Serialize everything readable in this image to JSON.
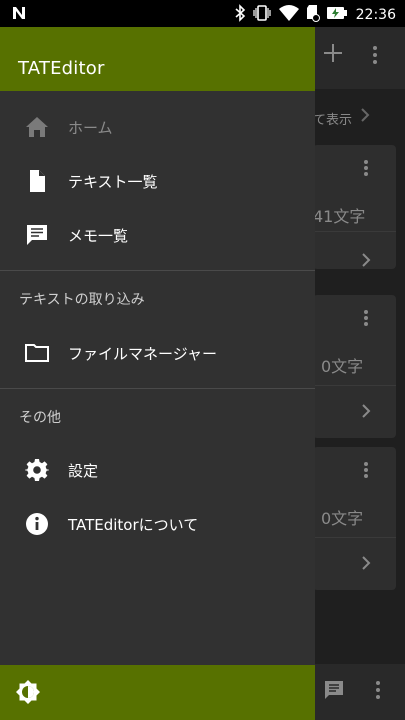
{
  "status_bar": {
    "time": "22:36",
    "left_icon": "n-notification-icon",
    "icons": [
      "bluetooth-icon",
      "vibrate-icon",
      "wifi-icon",
      "sd-card-icon",
      "battery-charging-icon"
    ]
  },
  "app_title": "TATEditor",
  "nav": {
    "home_label": "ホーム",
    "text_list_label": "テキスト一覧",
    "memo_list_label": "メモ一覧",
    "import_section": "テキストの取り込み",
    "file_manager_label": "ファイルマネージャー",
    "other_section": "その他",
    "settings_label": "設定",
    "about_label": "TATEditorについて"
  },
  "background": {
    "show_all_partial": "て表示",
    "cards": [
      {
        "count": "41文字"
      },
      {
        "count": "0文字"
      },
      {
        "count": "0文字"
      }
    ]
  },
  "colors": {
    "accent": "#577100",
    "drawer_bg": "#313131"
  },
  "footer": {
    "theme_icon": "brightness-icon"
  }
}
